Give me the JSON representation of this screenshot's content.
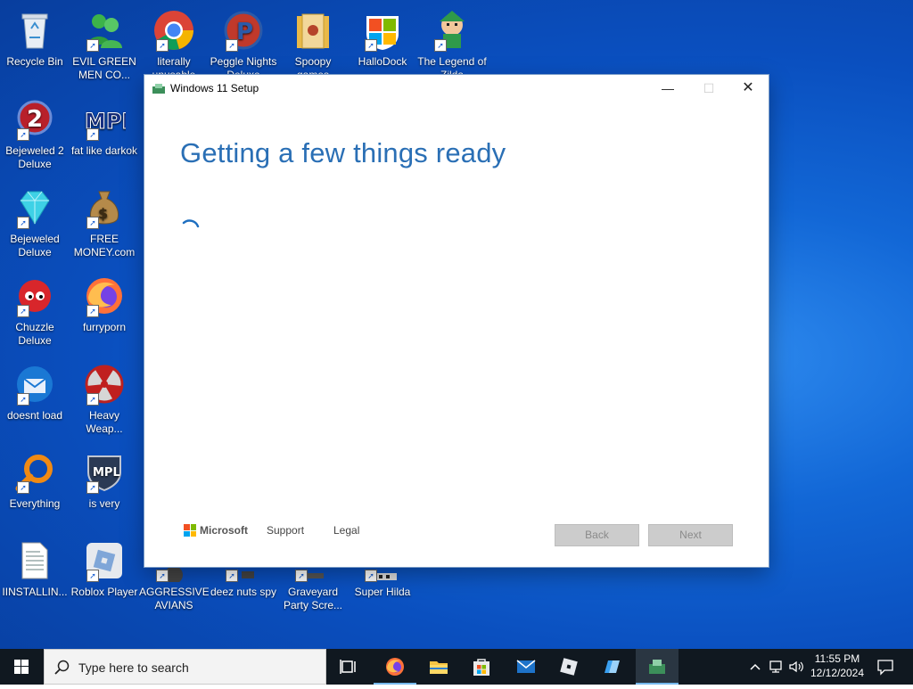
{
  "desktop": {
    "icons": [
      {
        "label": "Recycle Bin",
        "icon": "recycle-bin-icon"
      },
      {
        "label": "EVIL GREEN MEN CO...",
        "icon": "green-men-icon"
      },
      {
        "label": "literally unusable",
        "icon": "chrome-icon"
      },
      {
        "label": "Peggle Nights Deluxe",
        "icon": "peggle-icon"
      },
      {
        "label": "Spoopy games",
        "icon": "folder-icon"
      },
      {
        "label": "HalloDock",
        "icon": "windows-logo-icon"
      },
      {
        "label": "The Legend of Zilda",
        "icon": "zelda-icon"
      },
      {
        "label": "Bejeweled 2 Deluxe",
        "icon": "bejeweled2-icon"
      },
      {
        "label": "fat like darkok",
        "icon": "mpl-icon"
      },
      {
        "label": "Bejeweled Deluxe",
        "icon": "diamond-icon"
      },
      {
        "label": "FREE MONEY.com",
        "icon": "money-bag-icon"
      },
      {
        "label": "Chuzzle Deluxe",
        "icon": "chuzzle-icon"
      },
      {
        "label": "furryporn",
        "icon": "firefox-icon"
      },
      {
        "label": "doesnt load",
        "icon": "thunderbird-icon"
      },
      {
        "label": "Heavy Weap...",
        "icon": "radiation-icon"
      },
      {
        "label": "Everything",
        "icon": "everything-search-icon"
      },
      {
        "label": "is very",
        "icon": "mpl-shield-icon"
      },
      {
        "label": "IINSTALLIN...",
        "icon": "text-file-icon"
      },
      {
        "label": "Roblox Player",
        "icon": "roblox-icon"
      },
      {
        "label": "AGGRESSIVE AVIANS",
        "icon": "app-icon"
      },
      {
        "label": "deez nuts spy",
        "icon": "app-icon"
      },
      {
        "label": "Graveyard Party Scre...",
        "icon": "app-icon"
      },
      {
        "label": "Super Hilda",
        "icon": "app-icon"
      }
    ]
  },
  "setup": {
    "window_title": "Windows 11 Setup",
    "heading": "Getting a few things ready",
    "footer": {
      "brand": "Microsoft",
      "support": "Support",
      "legal": "Legal"
    },
    "buttons": {
      "back": "Back",
      "next": "Next"
    },
    "window_controls": {
      "minimize": "—",
      "maximize": "☐",
      "close": "✕"
    }
  },
  "taskbar": {
    "search_placeholder": "Type here to search",
    "clock_time": "11:55 PM",
    "clock_date": "12/12/2024"
  },
  "colors": {
    "accent": "#2a6fb5",
    "desktop_blue": "#0a4fbf",
    "taskbar": "#101820"
  }
}
